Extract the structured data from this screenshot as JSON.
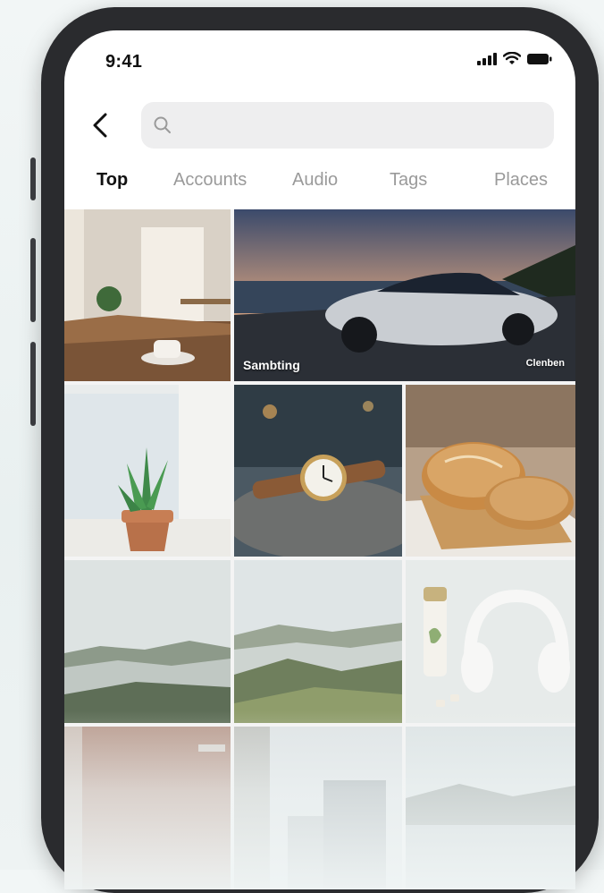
{
  "status_bar": {
    "time": "9:41",
    "icons": [
      "cellular-signal-icon",
      "wifi-icon",
      "battery-icon"
    ]
  },
  "search": {
    "placeholder": "",
    "value": "",
    "back_icon": "chevron-left-icon",
    "search_icon": "magnifier-icon"
  },
  "tabs": [
    {
      "label": "Top",
      "active": true
    },
    {
      "label": "Accounts",
      "active": false
    },
    {
      "label": "Audio",
      "active": false
    },
    {
      "label": "Tags",
      "active": false
    },
    {
      "label": "Places",
      "active": false
    }
  ],
  "grid": {
    "tiles": [
      {
        "name": "tile-cafe-coffee",
        "caption": ""
      },
      {
        "name": "tile-sports-car",
        "caption": "Sambting",
        "brand": "Clenben"
      },
      {
        "name": "tile-succulent-plant",
        "caption": ""
      },
      {
        "name": "tile-wristwatch",
        "caption": ""
      },
      {
        "name": "tile-bread-loaves",
        "caption": ""
      },
      {
        "name": "tile-misty-hills-1",
        "caption": ""
      },
      {
        "name": "tile-misty-hills-2",
        "caption": ""
      },
      {
        "name": "tile-headphones-bottle",
        "caption": ""
      },
      {
        "name": "tile-brick-building",
        "caption": ""
      },
      {
        "name": "tile-city-towers",
        "caption": ""
      },
      {
        "name": "tile-lake-landscape",
        "caption": ""
      }
    ]
  },
  "colors": {
    "device_frame": "#2a2b2e",
    "screen_bg": "#ffffff",
    "search_bg": "#eeeeef",
    "tab_active": "#111111",
    "tab_inactive": "#9a9a9a",
    "page_bg": "#eef3f3"
  }
}
